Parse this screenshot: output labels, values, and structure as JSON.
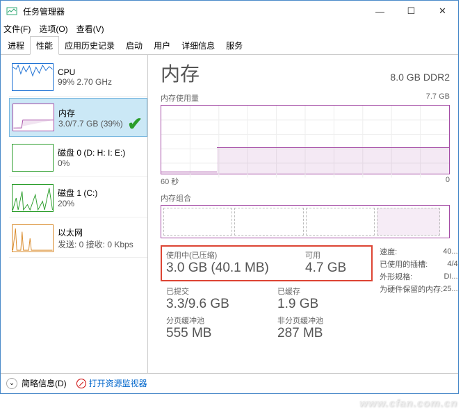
{
  "window": {
    "title": "任务管理器"
  },
  "menu": {
    "file": "文件(F)",
    "options": "选项(O)",
    "view": "查看(V)"
  },
  "tabs": [
    "进程",
    "性能",
    "应用历史记录",
    "启动",
    "用户",
    "详细信息",
    "服务"
  ],
  "sidebar": [
    {
      "name": "CPU",
      "sub": "99% 2.70 GHz",
      "color": "#1a6fd4"
    },
    {
      "name": "内存",
      "sub": "3.0/7.7 GB (39%)",
      "color": "#a349a4",
      "selected": true,
      "check": true
    },
    {
      "name": "磁盘 0 (D: H: I: E:)",
      "sub": "0%",
      "color": "#2a9d2a"
    },
    {
      "name": "磁盘 1 (C:)",
      "sub": "20%",
      "color": "#2a9d2a"
    },
    {
      "name": "以太网",
      "sub": "发送: 0 接收: 0 Kbps",
      "color": "#d98a2a"
    }
  ],
  "detail": {
    "title": "内存",
    "total": "8.0 GB DDR2",
    "usage_label": "内存使用量",
    "usage_max": "7.7 GB",
    "x_left": "60 秒",
    "x_right": "0",
    "composition_label": "内存组合",
    "inuse_label": "使用中(已压缩)",
    "inuse_value": "3.0 GB (40.1 MB)",
    "available_label": "可用",
    "available_value": "4.7 GB",
    "committed_label": "已提交",
    "committed_value": "3.3/9.6 GB",
    "cached_label": "已缓存",
    "cached_value": "1.9 GB",
    "paged_label": "分页缓冲池",
    "paged_value": "555 MB",
    "nonpaged_label": "非分页缓冲池",
    "nonpaged_value": "287 MB",
    "speed_label": "速度:",
    "speed_value": "40...",
    "slots_label": "已使用的插槽:",
    "slots_value": "4/4",
    "form_label": "外形规格:",
    "form_value": "DI...",
    "reserved_label": "为硬件保留的内存:",
    "reserved_value": "25..."
  },
  "footer": {
    "less": "简略信息(D)",
    "monitor": "打开资源监视器"
  },
  "watermark": "www.cfan.com.cn"
}
